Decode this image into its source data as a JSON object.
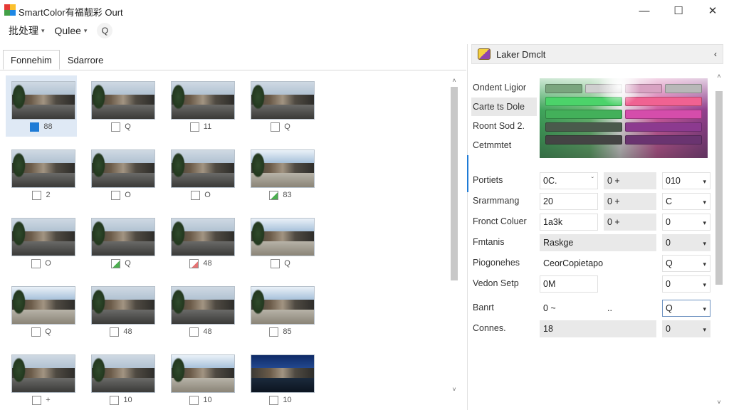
{
  "window": {
    "title": "SmartColor有福靓彩 Ourt",
    "minimize": "—",
    "maximize": "☐",
    "close": "✕"
  },
  "menubar": {
    "items": [
      {
        "label": "批处理"
      },
      {
        "label": "Qulee"
      }
    ],
    "search_icon": "Q"
  },
  "left_panel": {
    "tabs": [
      {
        "label": "Fonnehim"
      },
      {
        "label": "Sdarrore"
      }
    ],
    "thumbnails": [
      {
        "label": "88",
        "state": "checked",
        "selected": true,
        "variant": "street"
      },
      {
        "label": "Q",
        "state": "empty",
        "variant": "street"
      },
      {
        "label": "11",
        "state": "empty",
        "variant": "street"
      },
      {
        "label": "Q",
        "state": "empty",
        "variant": "street"
      },
      {
        "label": "2",
        "state": "empty",
        "variant": "street"
      },
      {
        "label": "O",
        "state": "empty",
        "variant": "street"
      },
      {
        "label": "O",
        "state": "empty",
        "variant": "street"
      },
      {
        "label": "83",
        "state": "partial",
        "variant": "bright"
      },
      {
        "label": "O",
        "state": "empty",
        "variant": "street"
      },
      {
        "label": "Q",
        "state": "partial",
        "variant": "street"
      },
      {
        "label": "48",
        "state": "red",
        "variant": "street"
      },
      {
        "label": "Q",
        "state": "empty",
        "variant": "bright"
      },
      {
        "label": "Q",
        "state": "empty",
        "variant": "bright"
      },
      {
        "label": "48",
        "state": "empty",
        "variant": "street"
      },
      {
        "label": "48",
        "state": "empty",
        "variant": "street"
      },
      {
        "label": "85",
        "state": "empty",
        "variant": "bright"
      },
      {
        "label": "+",
        "state": "empty",
        "variant": "street"
      },
      {
        "label": "10",
        "state": "empty",
        "variant": "street"
      },
      {
        "label": "10",
        "state": "empty",
        "variant": "bright"
      },
      {
        "label": "10",
        "state": "empty",
        "variant": "night"
      }
    ],
    "scroll_up": "˄",
    "scroll_down": "˅"
  },
  "right_panel": {
    "header": {
      "title": "Laker Dmclt",
      "collapse_icon": "‹"
    },
    "color_labels": [
      {
        "label": "Ondent Ligior"
      },
      {
        "label": "Carte ts Dole"
      },
      {
        "label": "Roont Sod 2."
      },
      {
        "label": "Cetmmtet"
      }
    ],
    "properties": [
      {
        "label": "Portiets",
        "f1": "0C.",
        "f1_suffix": "ˇ",
        "f2": "0 +",
        "f3": "010"
      },
      {
        "label": "Srarmmang",
        "f1": "20",
        "f2": "0 +",
        "f3": "C"
      },
      {
        "label": "Fronct Coluer",
        "f1": "1a3k",
        "f2": "0 +",
        "f3": "0"
      },
      {
        "label": "Fmtanis",
        "f1": "Raskge",
        "f3": "0"
      },
      {
        "label": "Piogonehes",
        "f1": "CeorCopietapo",
        "f3": "Q"
      },
      {
        "label": "Vedon Setp",
        "f1": "0M",
        "f3": "0"
      },
      {
        "label": "Banrt",
        "f1": "0 ~",
        "f2": "..",
        "f3": "Q"
      },
      {
        "label": "Connes.",
        "f1": "18",
        "f3": "0"
      }
    ],
    "dropdown_icon": "▾"
  },
  "colors": {
    "accent": "#1e7bd6",
    "selection": "#dfe9f5"
  }
}
